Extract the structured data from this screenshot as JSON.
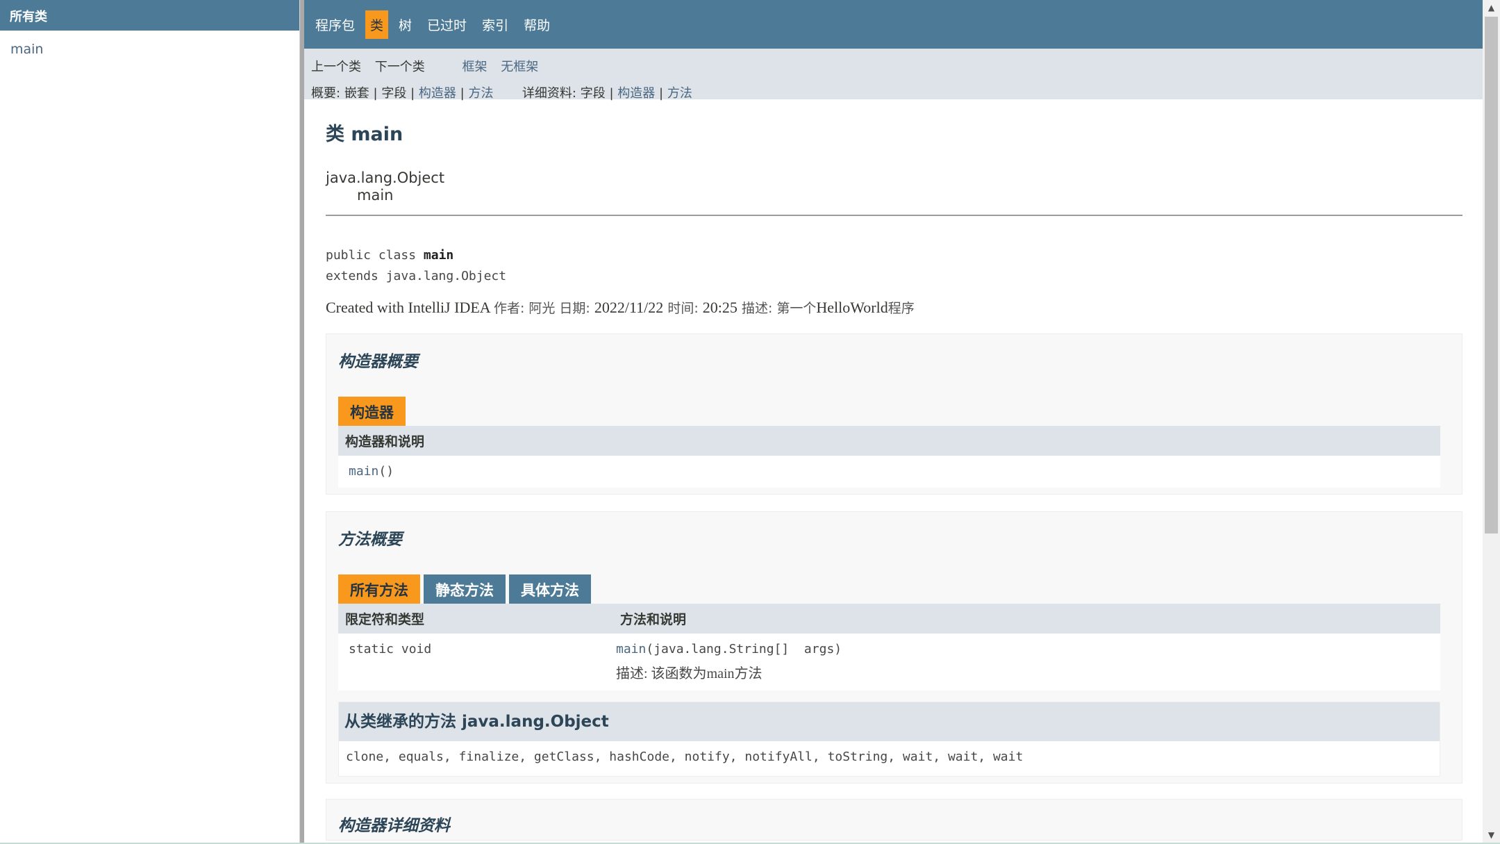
{
  "left_frame": {
    "title": "所有类",
    "classes": [
      "main"
    ]
  },
  "top_nav": {
    "items": [
      "程序包",
      "类",
      "树",
      "已过时",
      "索引",
      "帮助"
    ],
    "active": "类"
  },
  "sub_nav": {
    "prev_class": "上一个类",
    "next_class": "下一个类",
    "frames": "框架",
    "no_frames": "无框架",
    "summary_label": "概要:",
    "summary_nested": "嵌套",
    "summary_field": "字段",
    "summary_constructor": "构造器",
    "summary_method": "方法",
    "detail_label": "详细资料:",
    "detail_field": "字段",
    "detail_constructor": "构造器",
    "detail_method": "方法",
    "separator": "|"
  },
  "class_page": {
    "title": "类 main",
    "inheritance_parent": "java.lang.Object",
    "inheritance_child": "main",
    "decl_line1_prefix": "public class ",
    "decl_line1_name": "main",
    "decl_line2": "extends java.lang.Object",
    "description": {
      "part1": "Created with IntelliJ IDEA ",
      "author_label": "作者: 阿光 日期: ",
      "date": "2022/11/22",
      "time_label": " 时间: ",
      "time": "20:25",
      "desc_label": " 描述: 第一个",
      "hello": "HelloWorld",
      "program": "程序"
    }
  },
  "constructor_summary": {
    "heading": "构造器概要",
    "tab": "构造器",
    "column": "构造器和说明",
    "rows": [
      {
        "name": "main",
        "params": "()"
      }
    ]
  },
  "method_summary": {
    "heading": "方法概要",
    "tabs": [
      "所有方法",
      "静态方法",
      "具体方法"
    ],
    "columns": [
      "限定符和类型",
      "方法和说明"
    ],
    "rows": [
      {
        "type": "static void",
        "name": "main",
        "params": "(java.lang.String[]  args)",
        "note_prefix": "描述: 该函数为",
        "note_name": "main",
        "note_suffix": "方法"
      }
    ]
  },
  "inherited_methods": {
    "heading": "从类继承的方法 java.lang.Object",
    "list": "clone, equals, finalize, getClass, hashCode, notify, notifyAll, toString, wait, wait, wait"
  },
  "constructor_detail": {
    "heading": "构造器详细资料"
  },
  "colors": {
    "nav_bg": "#4d7a97",
    "active_tab": "#f8981d",
    "subnav_bg": "#dee3e9",
    "link": "#4a6782"
  }
}
